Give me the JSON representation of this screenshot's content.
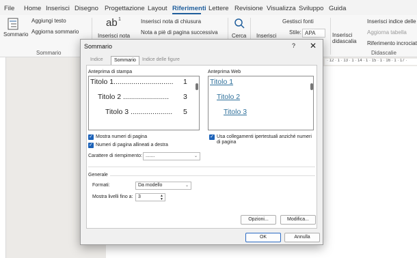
{
  "menu": [
    "File",
    "Home",
    "Inserisci",
    "Disegno",
    "Progettazione",
    "Layout",
    "Riferimenti",
    "Lettere",
    "Revisione",
    "Visualizza",
    "Sviluppo",
    "Guida"
  ],
  "ribbon": {
    "sommario_label": "Sommario",
    "aggiungi_testo": "Aggiungi testo",
    "aggiorna_sommario": "Aggiorna sommario",
    "group_sommario": "Sommario",
    "ab_label": "ab",
    "ab_sup": "1",
    "inserisci_nota": "Inserisci nota",
    "inserisci_nota_chiusura": "Inserisci nota di chiusura",
    "nota_pie_pagina": "Nota a piè di pagina successiva",
    "cerca": "Cerca",
    "inserisci": "Inserisci",
    "gestisci_fonti": "Gestisci fonti",
    "stile_label": "Stile:",
    "stile_value": "APA",
    "inserisci_didascalia": "Inserisci didascalia",
    "inserisci_indice_figure": "Inserisci indice delle fi",
    "aggiorna_tabella": "Aggiorna tabella",
    "riferimento_incrociato": "Riferimento incrociato",
    "group_didascalie": "Didascalie"
  },
  "ruler": "· 12 · 1 · 13 · 1 · 14 · 1 · 15 · 1 · 16 · 1 · 17 ·",
  "dialog": {
    "title": "Sommario",
    "help": "?",
    "close": "✕",
    "tabs": [
      "Indice",
      "Sommario",
      "Indice delle figure"
    ],
    "print_preview_label": "Anteprima di stampa",
    "print_preview_lines": [
      {
        "text": "Titolo 1..............................",
        "page": "1"
      },
      {
        "text": "Titolo 2 .......................",
        "page": "3"
      },
      {
        "text": "Titolo 3 .....................",
        "page": "5"
      }
    ],
    "web_preview_label": "Anteprima Web",
    "web_preview_links": [
      "Titolo 1",
      "Titolo 2",
      "Titolo 3"
    ],
    "show_page_numbers": "Mostra numeri di pagina",
    "align_page_numbers": "Numeri di pagina allineati a destra",
    "fill_char_label": "Carattere di riempimento:",
    "fill_char_value": ".......",
    "hyperlinks_label": "Usa collegamenti ipertestuali anziché numeri di pagina",
    "general_label": "Generale",
    "formats_label": "Formati:",
    "formats_value": "Da modello",
    "levels_label": "Mostra livelli fino a:",
    "levels_value": "3",
    "options_button": "Opzioni...",
    "modify_button": "Modifica...",
    "ok_button": "OK",
    "cancel_button": "Annulla"
  }
}
